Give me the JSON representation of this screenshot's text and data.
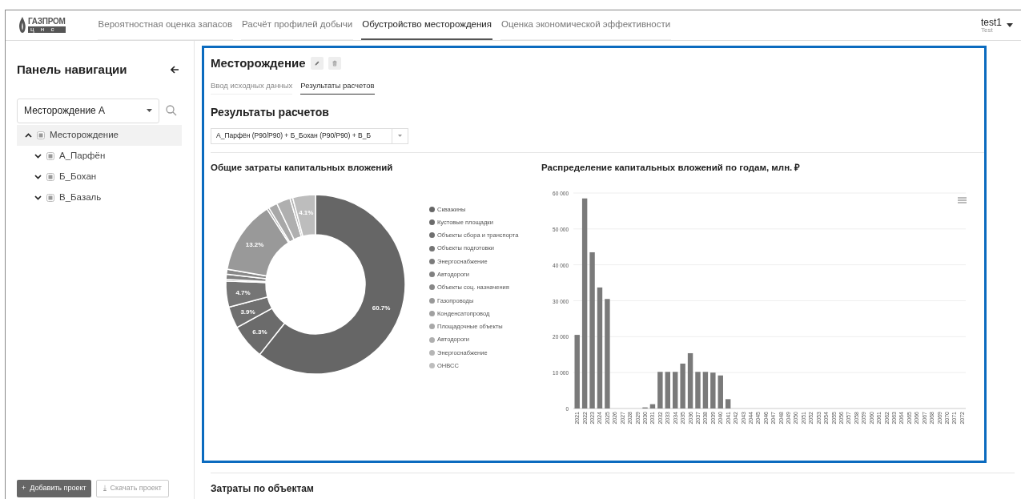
{
  "header": {
    "logo_text": "ГАЗПРОМ",
    "logo_subtext": "ц н с",
    "nav": [
      {
        "label": "Вероятностная оценка запасов",
        "selected": false
      },
      {
        "label": "Расчёт профилей добычи",
        "selected": false
      },
      {
        "label": "Обустройство месторождения",
        "selected": true
      },
      {
        "label": "Оценка экономической эффективности",
        "selected": false
      }
    ],
    "user": {
      "name": "test1",
      "role": "Test"
    }
  },
  "sidebar": {
    "title": "Панель навигации",
    "project_select": {
      "value": "Месторождение А"
    },
    "tree": [
      {
        "label": "Месторождение",
        "expanded": true,
        "selected": true,
        "children": [
          {
            "label": "А_Парфён",
            "expanded": false,
            "selected": false
          },
          {
            "label": "Б_Бохан",
            "expanded": false,
            "selected": false
          },
          {
            "label": "В_Базаль",
            "expanded": false,
            "selected": false
          }
        ]
      }
    ],
    "buttons": [
      {
        "label": "Добавить проект",
        "icon": "+",
        "kind": "primary"
      },
      {
        "label": "Скачать проект",
        "icon": "⤓",
        "kind": "secondary"
      }
    ]
  },
  "main": {
    "title": "Месторождение",
    "tabs": [
      {
        "label": "Ввод исходных данных",
        "selected": false
      },
      {
        "label": "Результаты расчетов",
        "selected": true
      }
    ],
    "section_title": "Результаты расчетов",
    "scenario_select": {
      "value": "А_Парфён (P90/P90) + Б_Бохан (P90/P90) + В_Б"
    },
    "pie_panel": {
      "title": "Общие затраты капитальных вложений",
      "chart_data": {
        "type": "donut",
        "categories": [
          "Скважины",
          "Кустовые площадки",
          "Объекты сбора и транспорта",
          "Объекты подготовки",
          "Энергоснабжение",
          "Автодороги",
          "Объекты соц. назначения",
          "Газопроводы",
          "Конденсатопровод",
          "Площадочные объекты",
          "Автодороги",
          "Энергоснабжение",
          "ОНВСС"
        ],
        "values": [
          60.7,
          6.3,
          3.9,
          4.7,
          0.3,
          0.9,
          0.9,
          13.2,
          0.4,
          1.6,
          2.5,
          0.5,
          4.1
        ],
        "colors": [
          "#666666",
          "#6b6b6b",
          "#707070",
          "#757575",
          "#7b7b7b",
          "#808080",
          "#888888",
          "#999999",
          "#a0a0a0",
          "#a8a8a8",
          "#afafaf",
          "#b5b5b5",
          "#bdbdbd"
        ],
        "value_labels": [
          "60.7%",
          "6.3%",
          "3.9%",
          "4.7%",
          null,
          null,
          null,
          "13.2%",
          null,
          null,
          null,
          null,
          "4.1%"
        ]
      }
    },
    "bar_panel": {
      "title": "Распределение капитальных вложений по годам, млн. ₽",
      "chart_data": {
        "type": "bar",
        "grid": true,
        "ylim": [
          0,
          60000
        ],
        "yticks": [
          {
            "value": 0,
            "label": "0"
          },
          {
            "value": 10000,
            "label": "10 000"
          },
          {
            "value": 20000,
            "label": "20 000"
          },
          {
            "value": 30000,
            "label": "30 000"
          },
          {
            "value": 40000,
            "label": "40 000"
          },
          {
            "value": 50000,
            "label": "50 000"
          },
          {
            "value": 60000,
            "label": "60 000"
          }
        ],
        "categories": [
          "2021",
          "2022",
          "2023",
          "2024",
          "2025",
          "2026",
          "2027",
          "2028",
          "2029",
          "2030",
          "2031",
          "2032",
          "2033",
          "2034",
          "2035",
          "2036",
          "2037",
          "2038",
          "2039",
          "2040",
          "2041",
          "2042",
          "2043",
          "2044",
          "2045",
          "2046",
          "2047",
          "2048",
          "2049",
          "2050",
          "2051",
          "2052",
          "2053",
          "2054",
          "2055",
          "2056",
          "2057",
          "2058",
          "2059",
          "2060",
          "2061",
          "2062",
          "2063",
          "2064",
          "2065",
          "2066",
          "2067",
          "2068",
          "2069",
          "2070",
          "2071",
          "2072"
        ],
        "values": [
          20500,
          58500,
          43500,
          33700,
          30500,
          0,
          0,
          0,
          0,
          300,
          1200,
          10200,
          10200,
          10200,
          12500,
          15400,
          10200,
          10200,
          10000,
          9200,
          2600,
          0,
          0,
          0,
          0,
          0,
          0,
          0,
          0,
          0,
          0,
          0,
          0,
          0,
          0,
          0,
          0,
          0,
          0,
          0,
          0,
          0,
          0,
          0,
          0,
          0,
          0,
          0,
          0,
          0,
          0,
          0
        ]
      }
    },
    "next_section_title": "Затраты по объектам"
  }
}
